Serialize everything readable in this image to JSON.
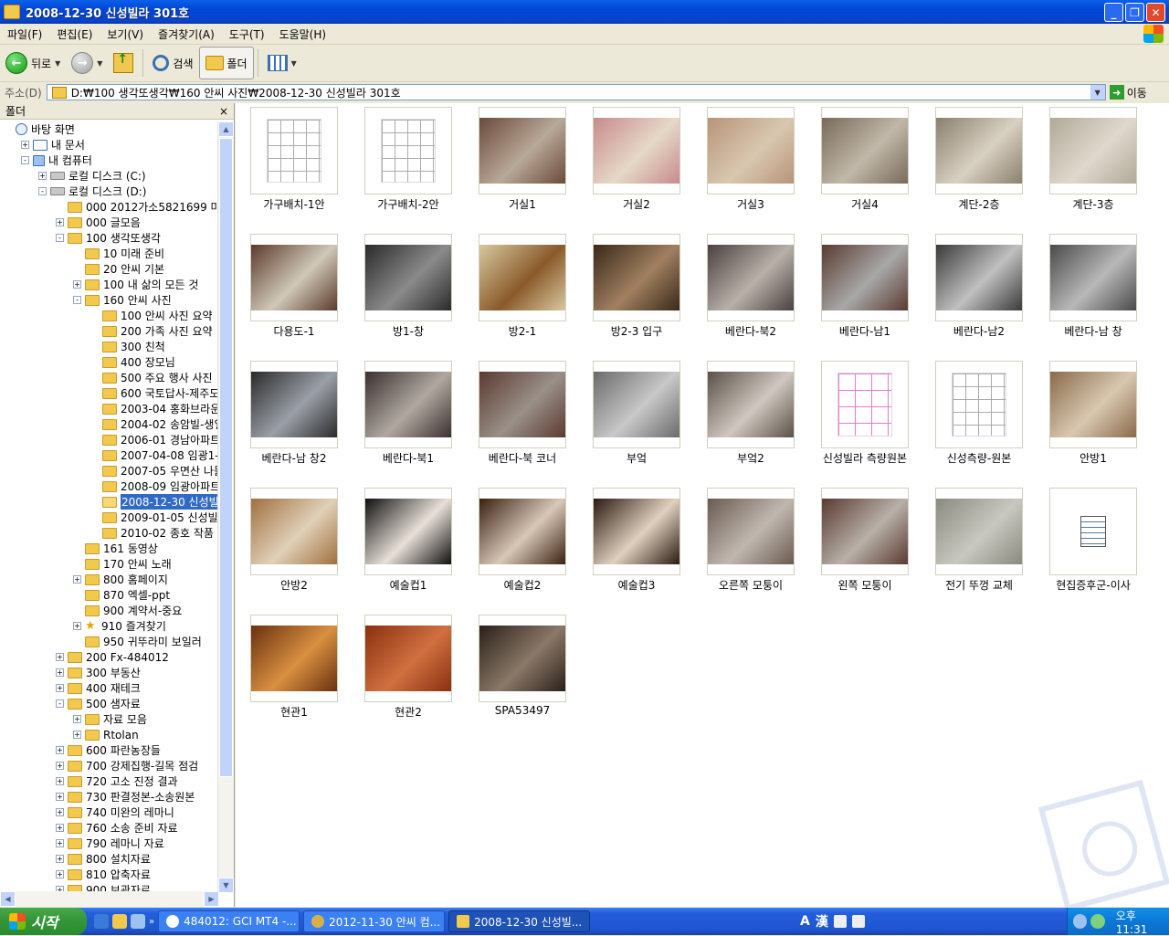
{
  "window": {
    "title": "2008-12-30 신성빌라 301호",
    "colors": {
      "titlebar": "#0a5fe8",
      "selection": "#316ac5"
    }
  },
  "window_controls": {
    "minimize": "_",
    "maximize": "❐",
    "close": "✕"
  },
  "menu": [
    "파일(F)",
    "편집(E)",
    "보기(V)",
    "즐겨찾기(A)",
    "도구(T)",
    "도움말(H)"
  ],
  "toolbar": {
    "back_label": "뒤로",
    "search_label": "검색",
    "folders_label": "폴더"
  },
  "address": {
    "label": "주소(D)",
    "path": "D:₩100 생각또생각₩160 안씨 사진₩2008-12-30 신성빌라 301호",
    "go_label": "이동"
  },
  "folder_pane": {
    "title": "폴더",
    "close": "×",
    "tree": [
      {
        "label": "바탕 화면",
        "level": 0,
        "exp": "",
        "icon": "desktop"
      },
      {
        "label": "내 문서",
        "level": 1,
        "exp": "+",
        "icon": "docs"
      },
      {
        "label": "내 컴퓨터",
        "level": 1,
        "exp": "-",
        "icon": "computer"
      },
      {
        "label": "로컬 디스크 (C:)",
        "level": 2,
        "exp": "+",
        "icon": "drive"
      },
      {
        "label": "로컬 디스크 (D:)",
        "level": 2,
        "exp": "-",
        "icon": "drive"
      },
      {
        "label": "000 2012가소5821699 마란드리",
        "level": 3,
        "exp": "",
        "icon": "folder"
      },
      {
        "label": "000 글모음",
        "level": 3,
        "exp": "+",
        "icon": "folder"
      },
      {
        "label": "100 생각또생각",
        "level": 3,
        "exp": "-",
        "icon": "folder"
      },
      {
        "label": "10 미래 준비",
        "level": 4,
        "exp": "",
        "icon": "folder"
      },
      {
        "label": "20 안씨 기본",
        "level": 4,
        "exp": "",
        "icon": "folder"
      },
      {
        "label": "100 내 삶의 모든 것",
        "level": 4,
        "exp": "+",
        "icon": "folder"
      },
      {
        "label": "160 안씨 사진",
        "level": 4,
        "exp": "-",
        "icon": "folder"
      },
      {
        "label": "100 안씨 사진 요약",
        "level": 5,
        "exp": "",
        "icon": "folder"
      },
      {
        "label": "200 가족 사진 요약",
        "level": 5,
        "exp": "",
        "icon": "folder"
      },
      {
        "label": "300 친척",
        "level": 5,
        "exp": "",
        "icon": "folder"
      },
      {
        "label": "400 장모님",
        "level": 5,
        "exp": "",
        "icon": "folder"
      },
      {
        "label": "500 주요 행사 사진",
        "level": 5,
        "exp": "",
        "icon": "folder"
      },
      {
        "label": "600 국토답사-제주도",
        "level": 5,
        "exp": "",
        "icon": "folder"
      },
      {
        "label": "2003-04 홍화브라운10",
        "level": 5,
        "exp": "",
        "icon": "folder"
      },
      {
        "label": "2004-02 송암빌-생일-",
        "level": 5,
        "exp": "",
        "icon": "folder"
      },
      {
        "label": "2006-01 경남아파트 시",
        "level": 5,
        "exp": "",
        "icon": "folder"
      },
      {
        "label": "2007-04-08 임광1-110",
        "level": 5,
        "exp": "",
        "icon": "folder"
      },
      {
        "label": "2007-05 우면산 나들이",
        "level": 5,
        "exp": "",
        "icon": "folder"
      },
      {
        "label": "2008-09 임광아파트",
        "level": 5,
        "exp": "",
        "icon": "folder"
      },
      {
        "label": "2008-12-30 신성빌라 3",
        "level": 5,
        "exp": "",
        "icon": "folder-open",
        "selected": true
      },
      {
        "label": "2009-01-05 신성빌라",
        "level": 5,
        "exp": "",
        "icon": "folder"
      },
      {
        "label": "2010-02 종호 작품",
        "level": 5,
        "exp": "",
        "icon": "folder"
      },
      {
        "label": "161 동영상",
        "level": 4,
        "exp": "",
        "icon": "folder"
      },
      {
        "label": "170 안씨 노래",
        "level": 4,
        "exp": "",
        "icon": "folder"
      },
      {
        "label": "800 홈페이지",
        "level": 4,
        "exp": "+",
        "icon": "folder"
      },
      {
        "label": "870 엑셀-ppt",
        "level": 4,
        "exp": "",
        "icon": "folder"
      },
      {
        "label": "900 계약서-중요",
        "level": 4,
        "exp": "",
        "icon": "folder"
      },
      {
        "label": "910 즐겨찾기",
        "level": 4,
        "exp": "+",
        "icon": "star"
      },
      {
        "label": "950 귀뚜라미 보일러",
        "level": 4,
        "exp": "",
        "icon": "folder"
      },
      {
        "label": "200 Fx-484012",
        "level": 3,
        "exp": "+",
        "icon": "folder"
      },
      {
        "label": "300 부동산",
        "level": 3,
        "exp": "+",
        "icon": "folder"
      },
      {
        "label": "400 재테크",
        "level": 3,
        "exp": "+",
        "icon": "folder"
      },
      {
        "label": "500 샘자료",
        "level": 3,
        "exp": "-",
        "icon": "folder"
      },
      {
        "label": "자료 모음",
        "level": 4,
        "exp": "+",
        "icon": "folder"
      },
      {
        "label": "Rtolan",
        "level": 4,
        "exp": "+",
        "icon": "folder"
      },
      {
        "label": "600 파란농장들",
        "level": 3,
        "exp": "+",
        "icon": "folder"
      },
      {
        "label": "700 강제집행-길목 점검",
        "level": 3,
        "exp": "+",
        "icon": "folder"
      },
      {
        "label": "720 고소 진정 결과",
        "level": 3,
        "exp": "+",
        "icon": "folder"
      },
      {
        "label": "730 판결정본-소송원본",
        "level": 3,
        "exp": "+",
        "icon": "folder"
      },
      {
        "label": "740 미완의 레마니",
        "level": 3,
        "exp": "+",
        "icon": "folder"
      },
      {
        "label": "760 소송 준비 자료",
        "level": 3,
        "exp": "+",
        "icon": "folder"
      },
      {
        "label": "790 레마니 자료",
        "level": 3,
        "exp": "+",
        "icon": "folder"
      },
      {
        "label": "800 설치자료",
        "level": 3,
        "exp": "+",
        "icon": "folder"
      },
      {
        "label": "810 압축자료",
        "level": 3,
        "exp": "+",
        "icon": "folder"
      },
      {
        "label": "900 보관자료",
        "level": 3,
        "exp": "+",
        "icon": "folder"
      }
    ]
  },
  "files": [
    {
      "name": "가구배치-1안",
      "kind": "plan",
      "c1": "#ffffff",
      "c2": "#eeeeee"
    },
    {
      "name": "가구배치-2안",
      "kind": "plan",
      "c1": "#ffffff",
      "c2": "#eeeeee"
    },
    {
      "name": "거실1",
      "kind": "photo",
      "c1": "#6b4a3a",
      "c2": "#b8a898"
    },
    {
      "name": "거실2",
      "kind": "photo",
      "c1": "#c88b8b",
      "c2": "#e6d8c8"
    },
    {
      "name": "거실3",
      "kind": "photo",
      "c1": "#b89478",
      "c2": "#d8c8b0"
    },
    {
      "name": "거실4",
      "kind": "photo",
      "c1": "#7a6a5a",
      "c2": "#c0b8a8"
    },
    {
      "name": "계단-2층",
      "kind": "photo",
      "c1": "#8a8070",
      "c2": "#d8d0c0"
    },
    {
      "name": "계단-3층",
      "kind": "photo",
      "c1": "#b0a898",
      "c2": "#e0d8cc"
    },
    {
      "name": "다용도-1",
      "kind": "photo",
      "c1": "#5a3a2a",
      "c2": "#d0c8b8"
    },
    {
      "name": "방1-창",
      "kind": "photo",
      "c1": "#2a2a2a",
      "c2": "#8a8a8a"
    },
    {
      "name": "방2-1",
      "kind": "photo",
      "c1": "#d8c8a0",
      "c2": "#8a5a2a"
    },
    {
      "name": "방2-3 입구",
      "kind": "photo",
      "c1": "#3a2818",
      "c2": "#a08060"
    },
    {
      "name": "베란다-북2",
      "kind": "photo",
      "c1": "#4a4040",
      "c2": "#b8b0a8"
    },
    {
      "name": "베란다-남1",
      "kind": "photo",
      "c1": "#5a3a30",
      "c2": "#a8a8a8"
    },
    {
      "name": "베란다-남2",
      "kind": "photo",
      "c1": "#3a3a3a",
      "c2": "#c0c0c0"
    },
    {
      "name": "베란다-남 창",
      "kind": "photo",
      "c1": "#4a4a4a",
      "c2": "#b8b8b8"
    },
    {
      "name": "베란다-남 창2",
      "kind": "photo",
      "c1": "#2a2a2a",
      "c2": "#9aa0a8"
    },
    {
      "name": "베란다-북1",
      "kind": "photo",
      "c1": "#3a3030",
      "c2": "#b0a8a0"
    },
    {
      "name": "베란다-북 코너",
      "kind": "photo",
      "c1": "#5a3a30",
      "c2": "#9a9088"
    },
    {
      "name": "부엌",
      "kind": "photo",
      "c1": "#6a6a6a",
      "c2": "#c8c8c8"
    },
    {
      "name": "부엌2",
      "kind": "photo",
      "c1": "#5a5048",
      "c2": "#d0c8c0"
    },
    {
      "name": "신성빌라 측량원본",
      "kind": "plan-pink",
      "c1": "#ffffff",
      "c2": "#e040c0"
    },
    {
      "name": "신성측량-원본",
      "kind": "plan",
      "c1": "#ffffff",
      "c2": "#eeeeee"
    },
    {
      "name": "안방1",
      "kind": "photo",
      "c1": "#8a6a4a",
      "c2": "#d8c8b0"
    },
    {
      "name": "안방2",
      "kind": "photo",
      "c1": "#a07040",
      "c2": "#e0d0b8"
    },
    {
      "name": "예술컵1",
      "kind": "photo",
      "c1": "#101010",
      "c2": "#e8e0d8"
    },
    {
      "name": "예술컵2",
      "kind": "photo",
      "c1": "#3a2010",
      "c2": "#d8c8b8"
    },
    {
      "name": "예술컵3",
      "kind": "photo",
      "c1": "#2a1a10",
      "c2": "#e0d0c0"
    },
    {
      "name": "오른쪽 모퉁이",
      "kind": "photo",
      "c1": "#6a5a50",
      "c2": "#c0b8b0"
    },
    {
      "name": "왼쪽 모퉁이",
      "kind": "photo",
      "c1": "#5a3a30",
      "c2": "#b8b0a8"
    },
    {
      "name": "전기 뚜껑 교체",
      "kind": "photo",
      "c1": "#8a8a80",
      "c2": "#c8c8c0"
    },
    {
      "name": "현집증후군-이사",
      "kind": "notepad",
      "c1": "#ffffff",
      "c2": "#ffffff"
    },
    {
      "name": "현관1",
      "kind": "photo",
      "c1": "#6a3010",
      "c2": "#d89040"
    },
    {
      "name": "현관2",
      "kind": "photo",
      "c1": "#8a3010",
      "c2": "#d07040"
    },
    {
      "name": "SPA53497",
      "kind": "photo",
      "c1": "#2a2018",
      "c2": "#8a7868"
    }
  ],
  "taskbar": {
    "start_label": "시작",
    "quick_chevron": "»",
    "tasks": [
      {
        "label": "484012: GCI MT4 -...",
        "active": false
      },
      {
        "label": "2012-11-30 안씨 컴...",
        "active": false
      },
      {
        "label": "2008-12-30 신성빌...",
        "active": true
      }
    ],
    "ime_a": "A",
    "ime_hanja": "漢",
    "clock": "오후 11:31"
  }
}
